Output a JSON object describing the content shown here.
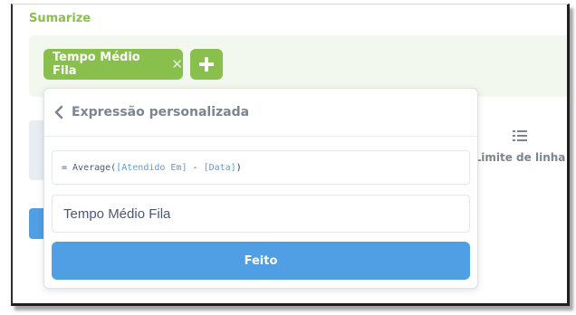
{
  "section": {
    "title": "Sumarize"
  },
  "aggregation": {
    "chip_label": "Tempo Médio Fila",
    "remove_glyph": "✕"
  },
  "sidebar_option": {
    "label": "Limite de linha",
    "icon": "list-icon"
  },
  "popover": {
    "title": "Expressão personalizada",
    "expression": {
      "prefix": "= Average(",
      "field1": "[Atendido Em]",
      "operator": " - ",
      "field2": "[Data]",
      "suffix": ")"
    },
    "name_value": "Tempo Médio Fila",
    "done_label": "Feito"
  },
  "colors": {
    "accent_green": "#88bf4d",
    "primary_blue": "#509ee3",
    "muted_text": "#7c858f"
  }
}
